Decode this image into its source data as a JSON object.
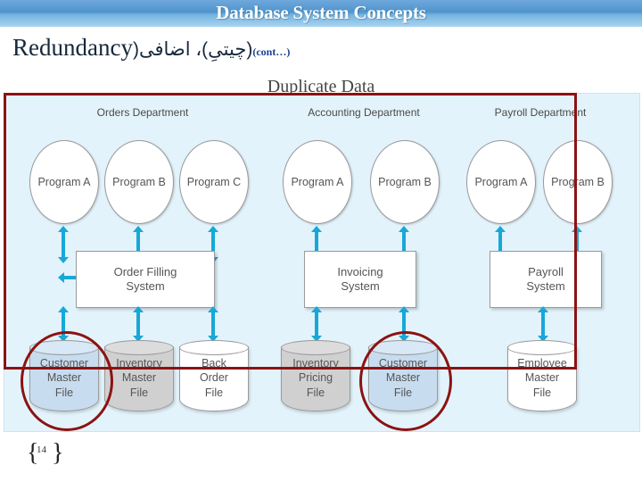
{
  "header": {
    "title": "Database System Concepts"
  },
  "slide": {
    "title_en": "Redundancy",
    "title_ur": "(چیتیِ)، اضافی(",
    "title_cont": "(cont…)",
    "number": "14"
  },
  "diagram": {
    "caption": "Duplicate Data",
    "departments": [
      {
        "label": "Orders Department"
      },
      {
        "label": "Accounting Department"
      },
      {
        "label": "Payroll Department"
      }
    ],
    "programs": [
      {
        "label": "Program A"
      },
      {
        "label": "Program B"
      },
      {
        "label": "Program C"
      },
      {
        "label": "Program A"
      },
      {
        "label": "Program B"
      },
      {
        "label": "Program A"
      },
      {
        "label": "Program B"
      }
    ],
    "systems": [
      {
        "line1": "Order Filling",
        "line2": "System"
      },
      {
        "line1": "Invoicing",
        "line2": "System"
      },
      {
        "line1": "Payroll",
        "line2": "System"
      }
    ],
    "files": [
      {
        "line1": "Customer",
        "line2": "Master",
        "line3": "File",
        "color": "blue"
      },
      {
        "line1": "Inventory",
        "line2": "Master",
        "line3": "File",
        "color": "gray"
      },
      {
        "line1": "Back",
        "line2": "Order",
        "line3": "File",
        "color": "white"
      },
      {
        "line1": "Inventory",
        "line2": "Pricing",
        "line3": "File",
        "color": "gray"
      },
      {
        "line1": "Customer",
        "line2": "Master",
        "line3": "File",
        "color": "blue"
      },
      {
        "line1": "Employee",
        "line2": "Master",
        "line3": "File",
        "color": "white"
      }
    ]
  },
  "colors": {
    "header_band": "#4f94cd",
    "arrow": "#17a8d8",
    "highlight": "#8c1212",
    "panel_bg": "#e3f3fb",
    "cont_text": "#1c3f94"
  }
}
